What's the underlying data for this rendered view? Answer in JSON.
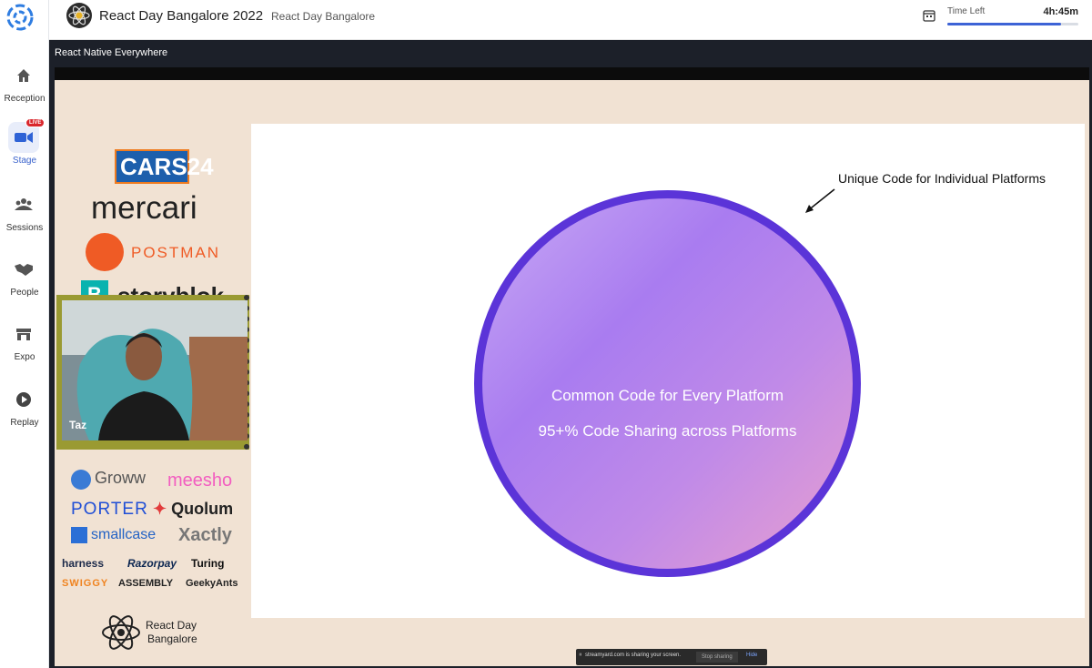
{
  "nav": {
    "items": [
      {
        "label": "Reception",
        "icon": "home-icon"
      },
      {
        "label": "Stage",
        "icon": "video-camera-icon",
        "badge": "LIVE"
      },
      {
        "label": "Sessions",
        "icon": "group-icon"
      },
      {
        "label": "People",
        "icon": "handshake-icon"
      },
      {
        "label": "Expo",
        "icon": "store-icon"
      },
      {
        "label": "Replay",
        "icon": "play-circle-icon"
      }
    ]
  },
  "header": {
    "event_title": "React Day Bangalore 2022",
    "event_subtitle": "React Day Bangalore",
    "time_left_label": "Time Left",
    "time_left_value": "4h:45m",
    "time_left_progress": 0.87
  },
  "stage": {
    "session_title": "React Native Everywhere",
    "speaker_name": "Taz",
    "sponsors_top": [
      "CARS24",
      "mercari",
      "POSTMAN",
      "storyblok"
    ],
    "sponsors_bottom": [
      "Groww",
      "meesho",
      "PORTER",
      "Quolum",
      "smallcase",
      "Xactly",
      "harness",
      "Razorpay",
      "Turing",
      "SWIGGY",
      "ASSEMBLY",
      "GeekyAnts"
    ],
    "cars_sub": "24",
    "event_logo_line1": "React Day",
    "event_logo_line2": "Bangalore"
  },
  "slide": {
    "annotation": "Unique Code for Individual Platforms",
    "circle_line1": "Common Code for Every Platform",
    "circle_line2": "95+% Code Sharing across Platforms"
  },
  "share_bar": {
    "message": "streamyard.com is sharing your screen.",
    "stop_label": "Stop sharing",
    "hide_label": "Hide"
  },
  "colors": {
    "accent": "#3d63d6",
    "live_badge": "#d9262c",
    "circle_border": "#5b34d8",
    "slide_bg": "#f1e2d3"
  }
}
